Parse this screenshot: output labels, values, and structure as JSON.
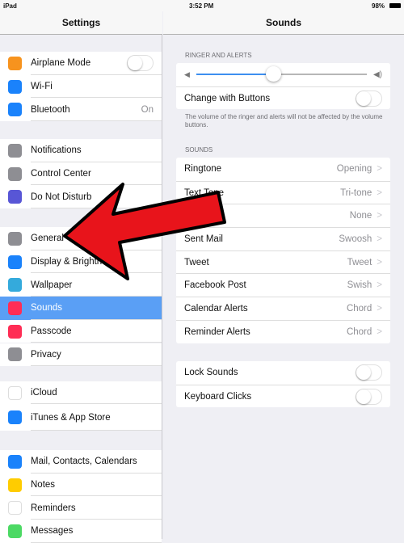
{
  "status": {
    "device": "iPad",
    "time": "3:52 PM",
    "battery": "98%"
  },
  "left": {
    "title": "Settings",
    "groups": [
      [
        {
          "label": "Airplane Mode",
          "icon": "airplane-icon",
          "color": "#f7931e",
          "toggle": false
        },
        {
          "label": "Wi-Fi",
          "icon": "wifi-icon",
          "color": "#1a82fb"
        },
        {
          "label": "Bluetooth",
          "icon": "bluetooth-icon",
          "color": "#1a82fb",
          "value": "On"
        }
      ],
      [
        {
          "label": "Notifications",
          "icon": "notifications-icon",
          "color": "#8e8e93"
        },
        {
          "label": "Control Center",
          "icon": "control-center-icon",
          "color": "#8e8e93"
        },
        {
          "label": "Do Not Disturb",
          "icon": "moon-icon",
          "color": "#5856d6"
        }
      ],
      [
        {
          "label": "General",
          "icon": "gear-icon",
          "color": "#8e8e93"
        },
        {
          "label": "Display & Brightness",
          "icon": "display-icon",
          "color": "#1a82fb"
        },
        {
          "label": "Wallpaper",
          "icon": "wallpaper-icon",
          "color": "#34aadc"
        },
        {
          "label": "Sounds",
          "icon": "speaker-icon",
          "color": "#ff2d55",
          "selected": true
        },
        {
          "label": "Passcode",
          "icon": "lock-icon",
          "color": "#ff2d55"
        },
        {
          "label": "Privacy",
          "icon": "hand-icon",
          "color": "#8e8e93"
        }
      ],
      [
        {
          "label": "iCloud",
          "icon": "cloud-icon",
          "color": "#ffffff"
        },
        {
          "label": "iTunes & App Store",
          "icon": "appstore-icon",
          "color": "#1a82fb"
        }
      ],
      [
        {
          "label": "Mail, Contacts, Calendars",
          "icon": "mail-icon",
          "color": "#1a82fb"
        },
        {
          "label": "Notes",
          "icon": "notes-icon",
          "color": "#ffcc00"
        },
        {
          "label": "Reminders",
          "icon": "reminders-icon",
          "color": "#ffffff"
        },
        {
          "label": "Messages",
          "icon": "messages-icon",
          "color": "#4cd964"
        }
      ]
    ]
  },
  "right": {
    "title": "Sounds",
    "ringer_header": "RINGER AND ALERTS",
    "volume": 0.45,
    "change_with_buttons": "Change with Buttons",
    "footer": "The volume of the ringer and alerts will not be affected by the volume buttons.",
    "sounds_header": "SOUNDS",
    "sounds": [
      {
        "label": "Ringtone",
        "value": "Opening"
      },
      {
        "label": "Text Tone",
        "value": "Tri-tone"
      },
      {
        "label": "",
        "value": "None"
      },
      {
        "label": "Sent Mail",
        "value": "Swoosh"
      },
      {
        "label": "Tweet",
        "value": "Tweet"
      },
      {
        "label": "Facebook Post",
        "value": "Swish"
      },
      {
        "label": "Calendar Alerts",
        "value": "Chord"
      },
      {
        "label": "Reminder Alerts",
        "value": "Chord"
      }
    ],
    "lock_sounds": "Lock Sounds",
    "keyboard_clicks": "Keyboard Clicks"
  },
  "colors": {
    "accent": "#5a9ff5",
    "arrow": "#e8141b"
  }
}
